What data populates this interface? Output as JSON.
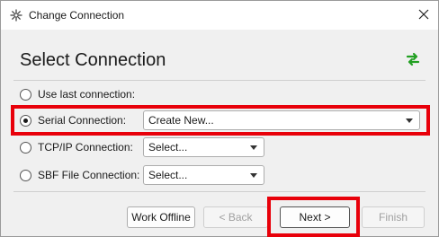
{
  "window": {
    "title": "Change Connection",
    "close_glyph": "✕"
  },
  "header": {
    "title": "Select Connection",
    "swap_icon": "swap-arrows-icon",
    "swap_color": "#22a022"
  },
  "options": [
    {
      "label": "Use last connection:",
      "checked": false
    },
    {
      "label": "Serial Connection:",
      "checked": true,
      "select_value": "Create New..."
    },
    {
      "label": "TCP/IP Connection:",
      "checked": false,
      "select_value": "Select..."
    },
    {
      "label": "SBF File Connection:",
      "checked": false,
      "select_value": "Select..."
    }
  ],
  "buttons": {
    "work_offline": "Work Offline",
    "back": "< Back",
    "next": "Next >",
    "finish": "Finish"
  },
  "colors": {
    "highlight": "#e8000a"
  }
}
